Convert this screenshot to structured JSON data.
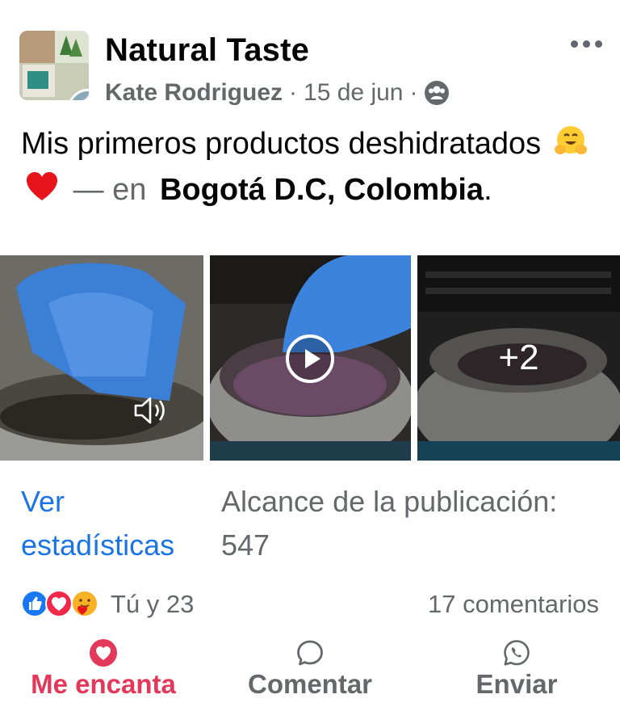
{
  "post": {
    "page_name": "Natural Taste",
    "author": "Kate Rodriguez",
    "separator": "·",
    "date": "15 de jun",
    "audience_icon": "friends-icon",
    "text": "Mis primeros productos deshidratados",
    "emojis": [
      "smiling-face-with-open-hands",
      "red-heart"
    ],
    "location_prefix": "— en",
    "location": "Bogotá D.C, Colombia",
    "location_suffix": "."
  },
  "media": {
    "items": [
      {
        "type": "video",
        "overlay_icon": "speaker-icon"
      },
      {
        "type": "video",
        "overlay_icon": "play-icon"
      },
      {
        "type": "photo",
        "more_count": "+2"
      }
    ]
  },
  "insights": {
    "link": "Ver estadísticas",
    "reach": "Alcance de la publicación: 547"
  },
  "reactions": {
    "icons": [
      "like-icon",
      "love-icon",
      "care-icon"
    ],
    "summary": "Tú y 23",
    "comments": "17 comentarios"
  },
  "actions": {
    "love": "Me encanta",
    "comment": "Comentar",
    "share": "Enviar"
  },
  "colors": {
    "link_blue": "#1b74e4",
    "love_red": "#e4385a",
    "secondary_text": "#65676b"
  }
}
